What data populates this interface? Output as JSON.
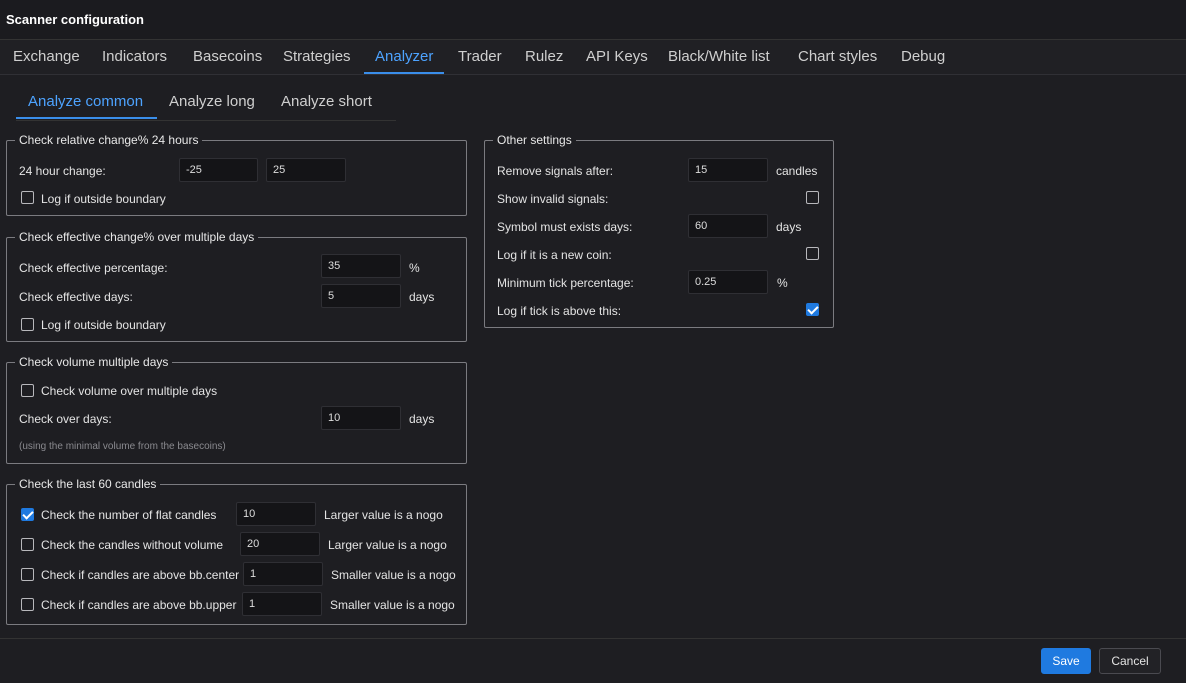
{
  "window": {
    "title": "Scanner configuration"
  },
  "tabs": [
    "Exchange",
    "Indicators",
    "Basecoins",
    "Strategies",
    "Analyzer",
    "Trader",
    "Rulez",
    "API Keys",
    "Black/White list",
    "Chart styles",
    "Debug"
  ],
  "subtabs": [
    "Analyze common",
    "Analyze long",
    "Analyze short"
  ],
  "relative_change": {
    "legend": "Check relative change% 24 hours",
    "change_label": "24 hour change:",
    "min_value": "-25",
    "max_value": "25",
    "log_label": "Log if outside boundary",
    "log_checked": false
  },
  "effective_change": {
    "legend": "Check effective change% over multiple days",
    "percentage_label": "Check effective percentage:",
    "percentage_value": "35",
    "percentage_unit": "%",
    "days_label": "Check effective days:",
    "days_value": "5",
    "days_unit": "days",
    "log_label": "Log if outside boundary",
    "log_checked": false
  },
  "volume": {
    "legend": "Check volume multiple days",
    "check_label": "Check volume over multiple days",
    "check_checked": false,
    "days_label": "Check over days:",
    "days_value": "10",
    "days_unit": "days",
    "hint": "(using the minimal volume from the basecoins)"
  },
  "candles": {
    "legend": "Check the last 60 candles",
    "rows": [
      {
        "label": "Check the number of flat candles",
        "checked": true,
        "value": "10",
        "note": "Larger value is a nogo"
      },
      {
        "label": "Check the candles without volume",
        "checked": false,
        "value": "20",
        "note": "Larger value is a nogo"
      },
      {
        "label": "Check if candles are above bb.center",
        "checked": false,
        "value": "1",
        "note": "Smaller value is a nogo"
      },
      {
        "label": "Check if candles are above bb.upper",
        "checked": false,
        "value": "1",
        "note": "Smaller value is a nogo"
      }
    ]
  },
  "other": {
    "legend": "Other settings",
    "remove_label": "Remove signals after:",
    "remove_value": "15",
    "remove_unit": "candles",
    "invalid_label": "Show invalid signals:",
    "invalid_checked": false,
    "exists_label": "Symbol must exists days:",
    "exists_value": "60",
    "exists_unit": "days",
    "newcoin_label": "Log if it is a new coin:",
    "newcoin_checked": false,
    "tick_label": "Minimum tick percentage:",
    "tick_value": "0.25",
    "tick_unit": "%",
    "tickabove_label": "Log if tick is above this:",
    "tickabove_checked": true
  },
  "footer": {
    "save_label": "Save",
    "cancel_label": "Cancel"
  },
  "colors": {
    "accent": "#1f7ae0",
    "active_tab": "#4da3ff",
    "background": "#1e1e22"
  }
}
